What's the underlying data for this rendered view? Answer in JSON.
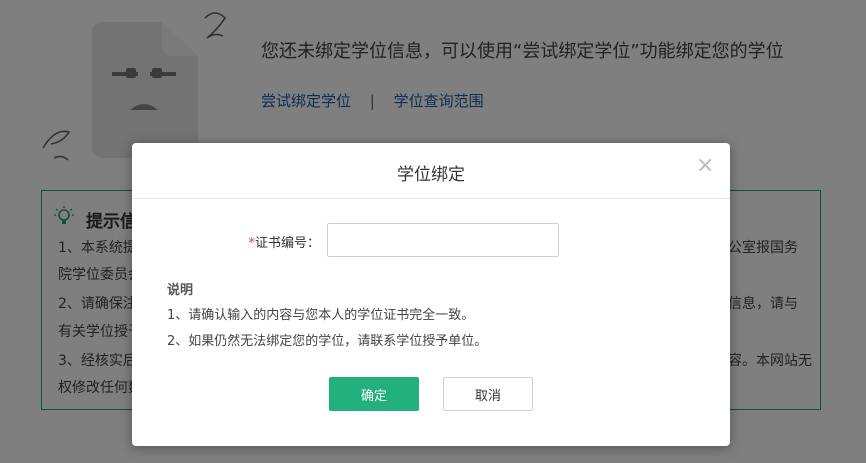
{
  "background": {
    "empty_message": "您还未绑定学位信息，可以使用“尝试绑定学位”功能绑定您的学位",
    "links": {
      "try_bind": "尝试绑定学位",
      "separator": "|",
      "query_scope": "学位查询范围"
    },
    "tips": {
      "title": "提示信",
      "lines": [
        {
          "left": "1、本系统提",
          "right": "公室报国务"
        },
        {
          "left": "院学位委员会",
          "right": ""
        },
        {
          "left": "2、请确保注",
          "right": "信息，请与"
        },
        {
          "left": "有关学位授予",
          "right": ""
        },
        {
          "left": "3、经核实后",
          "right": "容。本网站无"
        },
        {
          "left": "权修改任何数",
          "right": ""
        }
      ]
    }
  },
  "modal": {
    "title": "学位绑定",
    "close_symbol": "×",
    "cert_number": {
      "required_mark": "*",
      "label": "证书编号：",
      "value": "",
      "placeholder": ""
    },
    "notes": {
      "title": "说明",
      "items": [
        "1、请确认输入的内容与您本人的学位证书完全一致。",
        "2、如果仍然无法绑定您的学位，请联系学位授予单位。"
      ]
    },
    "confirm_label": "确定",
    "cancel_label": "取消"
  },
  "colors": {
    "accent_green": "#22b07d",
    "link_blue": "#1a5ea8",
    "required_red": "#e03c3c",
    "overlay": "rgba(0,0,0,0.5)"
  }
}
